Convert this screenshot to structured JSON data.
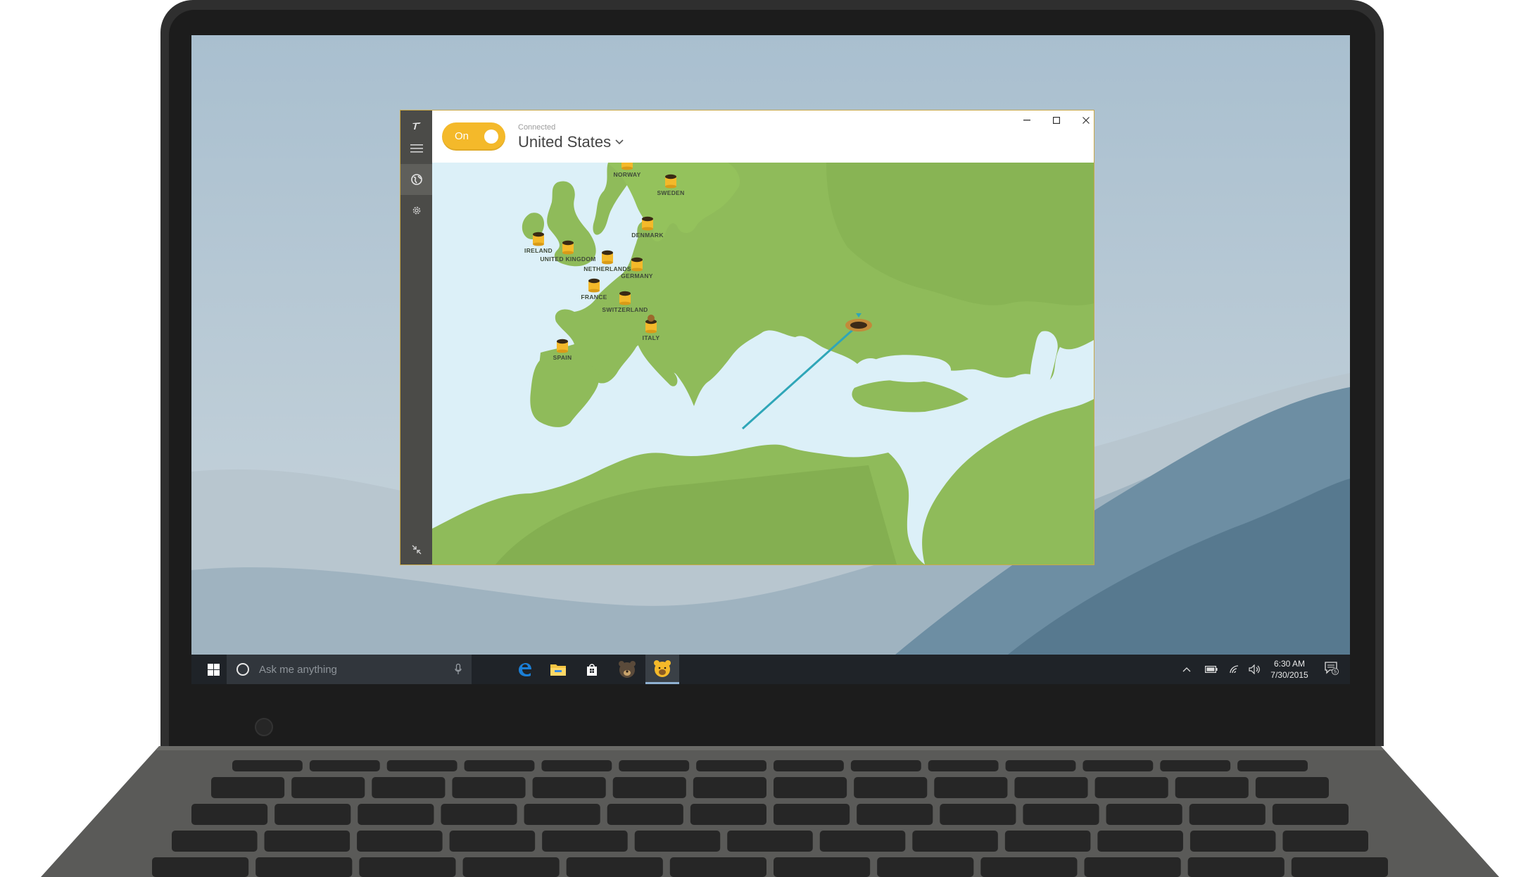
{
  "app": {
    "toggle_label": "On",
    "status_label": "Connected",
    "location": "United States",
    "accent_color": "#f4b92a",
    "sidebar": {
      "items": [
        {
          "icon": "logo-icon"
        },
        {
          "icon": "menu-icon"
        },
        {
          "icon": "globe-icon",
          "active": true
        },
        {
          "icon": "gear-icon"
        },
        {
          "icon": "minimize-arrows-icon"
        }
      ]
    },
    "window_controls": [
      "minimize-icon",
      "maximize-icon",
      "close-icon"
    ]
  },
  "map": {
    "servers": [
      {
        "name": "NORWAY"
      },
      {
        "name": "SWEDEN"
      },
      {
        "name": "DENMARK"
      },
      {
        "name": "IRELAND"
      },
      {
        "name": "UNITED KINGDOM"
      },
      {
        "name": "NETHERLANDS"
      },
      {
        "name": "GERMANY"
      },
      {
        "name": "FRANCE"
      },
      {
        "name": "SWITZERLAND"
      },
      {
        "name": "ITALY"
      },
      {
        "name": "SPAIN"
      }
    ],
    "connected_server": "ITALY",
    "land_color": "#8fbb5a",
    "sea_color": "#dcf0f8",
    "tunnel_color": "#2fa6b8"
  },
  "taskbar": {
    "search_placeholder": "Ask me anything",
    "apps": [
      "edge-icon",
      "file-explorer-icon",
      "store-icon",
      "bear-app-icon",
      "tunnelbear-icon"
    ],
    "active_app": "tunnelbear-icon",
    "tray": [
      "chevron-up-icon",
      "battery-icon",
      "wifi-icon",
      "volume-icon"
    ],
    "time": "6:30 AM",
    "date": "7/30/2015",
    "notification_count": "5"
  }
}
